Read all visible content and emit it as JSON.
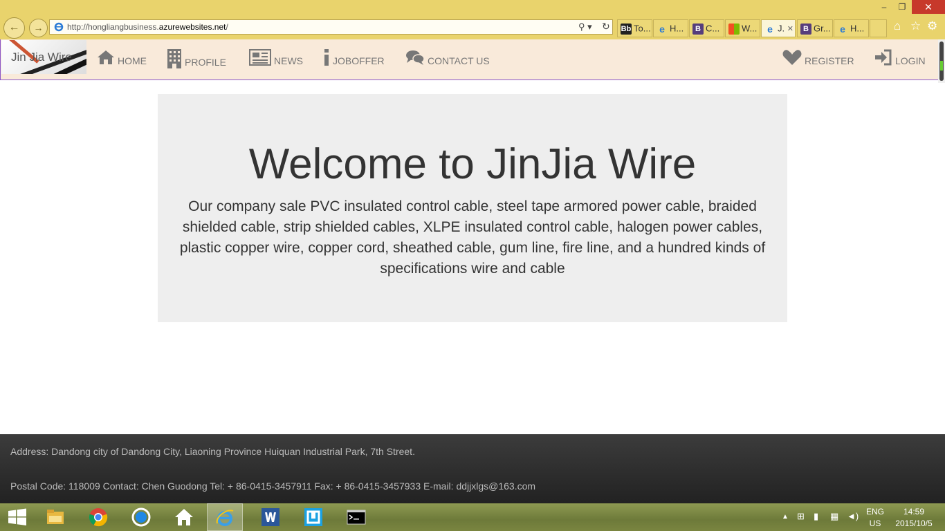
{
  "browser": {
    "window_controls": {
      "minimize": "‒",
      "restore": "❐",
      "close": "✕"
    },
    "url_prefix": "http://hongliangbusiness.",
    "url_domain": "azurewebsites.net",
    "url_suffix": "/",
    "tabs": [
      {
        "label": "To...",
        "icon": "bb-icon",
        "color": "#222222"
      },
      {
        "label": "H...",
        "icon": "ie-icon",
        "color": "#2b7bd6"
      },
      {
        "label": "C...",
        "icon": "bootstrap-icon",
        "color": "#563d7c"
      },
      {
        "label": "W...",
        "icon": "windows-icon",
        "color": "#1ea1f2"
      },
      {
        "label": "J.",
        "icon": "ie-icon",
        "color": "#2b7bd6",
        "active": true
      },
      {
        "label": "Gr...",
        "icon": "bootstrap-icon",
        "color": "#563d7c"
      },
      {
        "label": "H...",
        "icon": "ie-icon",
        "color": "#2b7bd6"
      }
    ],
    "tab_close": "✕"
  },
  "site": {
    "logo_text": "Jin Jia Wire",
    "nav": [
      {
        "label": "HOME",
        "icon": "home-icon"
      },
      {
        "label": "PROFILE",
        "icon": "building-icon"
      },
      {
        "label": "NEWS",
        "icon": "newspaper-icon"
      },
      {
        "label": "JOBOFFER",
        "icon": "info-icon"
      },
      {
        "label": "CONTACT US",
        "icon": "comments-icon"
      }
    ],
    "nav_right": [
      {
        "label": "REGISTER",
        "icon": "heart-icon"
      },
      {
        "label": "LOGIN",
        "icon": "login-icon"
      }
    ]
  },
  "jumbotron": {
    "title": "Welcome to JinJia Wire",
    "text": "Our company sale PVC insulated control cable, steel tape armored power cable, braided shielded cable, strip shielded cables, XLPE insulated control cable, halogen power cables, plastic copper wire, copper cord, sheathed cable, gum line, fire line, and a hundred kinds of specifications wire and cable"
  },
  "footer": {
    "address": "Address: Dandong city of Dandong City, Liaoning Province Huiquan Industrial Park, 7th Street.",
    "contact": "Postal Code: 118009 Contact: Chen Guodong Tel: + 86-0415-3457911 Fax: + 86-0415-3457933 E-mail: ddjjxlgs@163.com"
  },
  "taskbar": {
    "apps": [
      "start-icon",
      "file-explorer-icon",
      "chrome-icon",
      "onedrive-icon",
      "home-icon",
      "internet-explorer-icon",
      "word-icon",
      "app-icon",
      "command-prompt-icon"
    ],
    "lang_top": "ENG",
    "lang_bottom": "US",
    "time": "14:59",
    "date": "2015/10/5"
  }
}
